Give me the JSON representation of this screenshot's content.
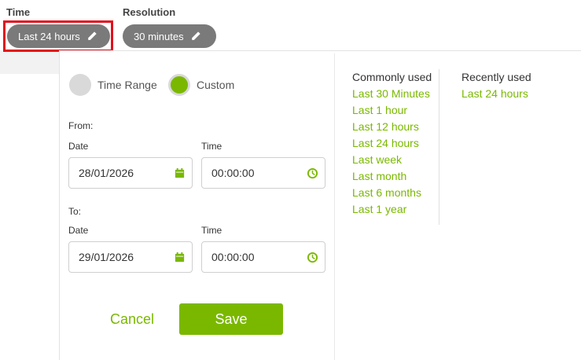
{
  "header": {
    "time_label": "Time",
    "time_value": "Last 24 hours",
    "resolution_label": "Resolution",
    "resolution_value": "30 minutes"
  },
  "mode": {
    "time_range_label": "Time Range",
    "custom_label": "Custom",
    "selected": "Custom"
  },
  "from": {
    "label": "From:",
    "date_label": "Date",
    "date_value": "28/01/2026",
    "time_label": "Time",
    "time_value": "00:00:00"
  },
  "to": {
    "label": "To:",
    "date_label": "Date",
    "date_value": "29/01/2026",
    "time_label": "Time",
    "time_value": "00:00:00"
  },
  "actions": {
    "cancel": "Cancel",
    "save": "Save"
  },
  "commonly_used": {
    "title": "Commonly used",
    "items": [
      "Last 30 Minutes",
      "Last 1 hour",
      "Last 12 hours",
      "Last 24 hours",
      "Last week",
      "Last month",
      "Last 6 months",
      "Last 1 year"
    ]
  },
  "recently_used": {
    "title": "Recently used",
    "items": [
      "Last 24 hours"
    ]
  },
  "colors": {
    "accent": "#7ab800",
    "pill": "#7a7a7a",
    "highlight": "#e3101c"
  },
  "icons": [
    "pencil-icon",
    "calendar-icon",
    "clock-icon"
  ]
}
